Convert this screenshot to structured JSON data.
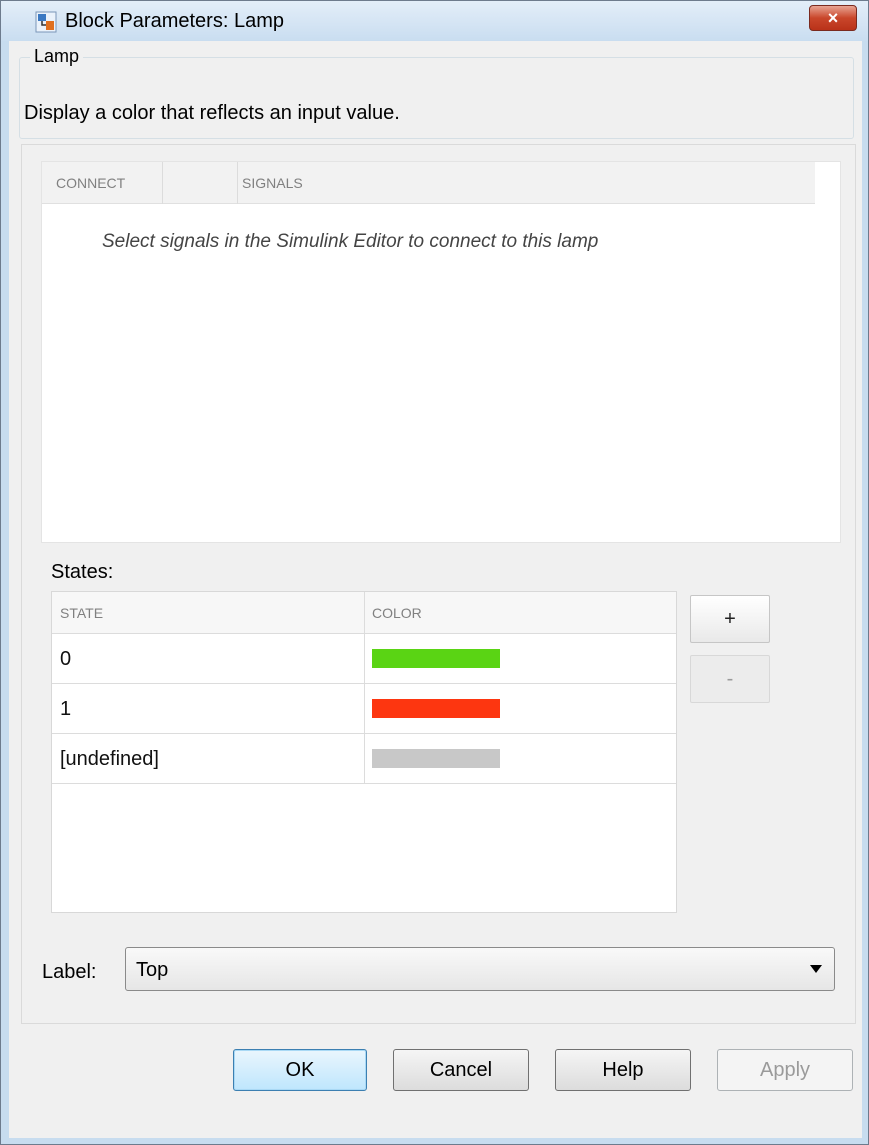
{
  "window": {
    "title": "Block Parameters: Lamp",
    "close_label": "×"
  },
  "description": {
    "group_title": "Lamp",
    "text": "Display a color that reflects an input value."
  },
  "signals_table": {
    "headers": [
      "CONNECT",
      "SIGNALS"
    ],
    "empty_message": "Select signals in the Simulink Editor to connect to this lamp"
  },
  "states": {
    "label": "States:",
    "headers": [
      "STATE",
      "COLOR"
    ],
    "rows": [
      {
        "state": "0",
        "color": "#5ad414"
      },
      {
        "state": "1",
        "color": "#fd3610"
      },
      {
        "state": "[undefined]",
        "color": "#c8c8c8"
      }
    ],
    "add_label": "+",
    "remove_label": "-"
  },
  "label_param": {
    "label": "Label:",
    "value": "Top"
  },
  "buttons": {
    "ok": "OK",
    "cancel": "Cancel",
    "help": "Help",
    "apply": "Apply"
  }
}
